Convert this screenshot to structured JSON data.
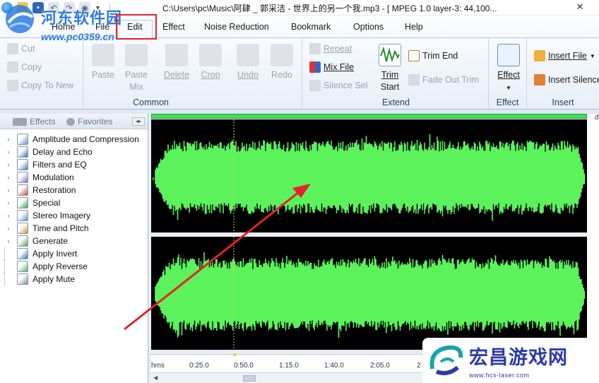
{
  "window": {
    "title": "C:\\Users\\pc\\Music\\阿肆 _ 郭采洁 - 世界上的另一个我.mp3 - [ MPEG 1.0 layer-3: 44,100...",
    "close_glyph": "✕"
  },
  "tabs": [
    "Home",
    "File",
    "Edit",
    "Effect",
    "Noise Reduction",
    "Bookmark",
    "Options",
    "Help"
  ],
  "active_tab": "Edit",
  "watermark_top": {
    "name": "河东软件园",
    "url": "www.pc0359.cn"
  },
  "watermark_bottom": {
    "name": "宏昌游戏网",
    "url": "www.hcs-laser.com"
  },
  "ribbon": {
    "clipboard": {
      "cut": "Cut",
      "copy": "Copy",
      "copy_to_new": "Copy To New"
    },
    "common": {
      "label": "Common",
      "paste": "Paste",
      "paste_mix_1": "Paste",
      "paste_mix_2": "Mix",
      "delete": "Delete",
      "crop": "Crop",
      "undo": "Undo",
      "redo": "Redo"
    },
    "extend": {
      "label": "Extend",
      "repeat": "Repeat",
      "mix_file": "Mix File",
      "silence_sel": "Silence Sel",
      "trim_start_1": "Trim",
      "trim_start_2": "Start",
      "trim_end": "Trim End",
      "fade_out_trim": "Fade Out Trim"
    },
    "effect": {
      "label": "Effect",
      "button": "Effect"
    },
    "insert": {
      "label": "Insert",
      "insert_file": "Insert File",
      "insert_silence": "Insert Silence"
    }
  },
  "left_panel": {
    "tab_effects": "Effects",
    "tab_favorites": "Favorites",
    "items": [
      {
        "label": "Amplitude and Compression",
        "expandable": true
      },
      {
        "label": "Delay and Echo",
        "expandable": true
      },
      {
        "label": "Filters and EQ",
        "expandable": true
      },
      {
        "label": "Modulation",
        "expandable": true
      },
      {
        "label": "Restoration",
        "expandable": true
      },
      {
        "label": "Special",
        "expandable": true
      },
      {
        "label": "Stereo Imagery",
        "expandable": true
      },
      {
        "label": "Time and Pitch",
        "expandable": true
      },
      {
        "label": "Generate",
        "expandable": true
      },
      {
        "label": "Apply Invert",
        "expandable": false
      },
      {
        "label": "Apply Reverse",
        "expandable": false
      },
      {
        "label": "Apply Mute",
        "expandable": false
      }
    ]
  },
  "timeline": {
    "ticks": [
      "hms",
      "0:25.0",
      "0:50.0",
      "1:15.0",
      "1:40.0",
      "2:05.0",
      "2"
    ]
  },
  "scale_labels": {
    "top": "d"
  },
  "colors": {
    "waveform": "#5cf25c",
    "annotation_red": "#e4232b",
    "ribbon_bg": "#e7eef7"
  }
}
